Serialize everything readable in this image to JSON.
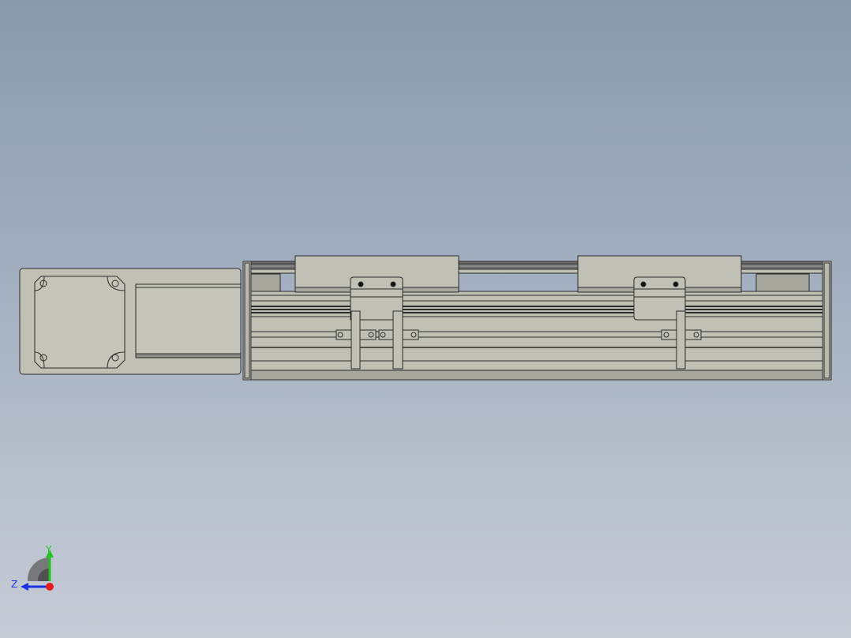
{
  "viewport": {
    "background_top": "#8a99ae",
    "background_bottom": "#c6ccd6"
  },
  "model": {
    "part_fill": "#c0c0b4",
    "part_fill_dark": "#a6a69c",
    "edge_color": "#2b2b2b",
    "hole_color": "#111111"
  },
  "triad": {
    "y_label": "Y",
    "z_label": "Z",
    "y_color": "#21c421",
    "z_color": "#1a33e6",
    "origin_color": "#e61c1c"
  }
}
